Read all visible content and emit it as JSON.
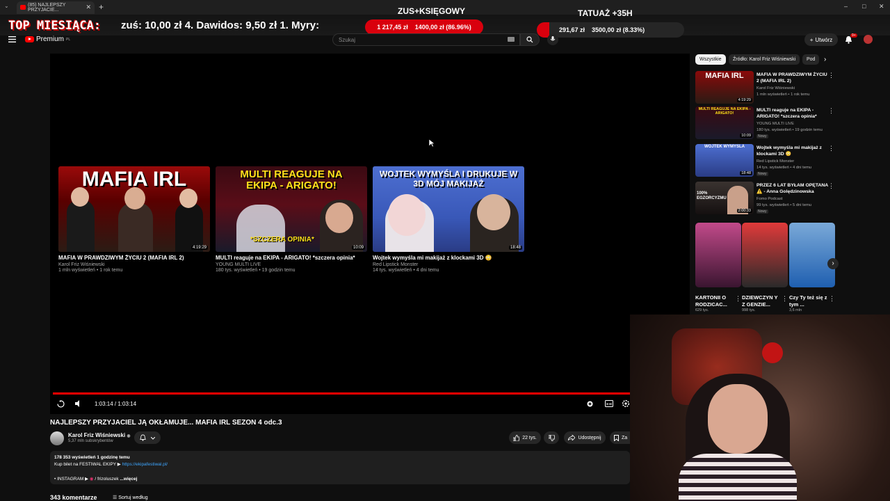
{
  "browser": {
    "tab_title": "(85) NAJLEPSZY PRZYJACIE...",
    "url_fragment": "v=zlhL8Dkc#M98",
    "new_tab": "+",
    "close": "✕",
    "window_controls": [
      "–",
      "□",
      "✕"
    ]
  },
  "overlay": {
    "top_label": "TOP MIESIĄCA:",
    "ticker": "zuś: 10,00 zł  4. Dawidos: 9,50 zł  1. Myry:",
    "goal1": {
      "title": "ZUS+KSIĘGOWY",
      "current": "1 217,45 zł",
      "target": "1400,00 zł (86.96%)",
      "percent": 86.96
    },
    "goal2": {
      "title": "TATUAŻ +35H",
      "current": "291,67 zł",
      "target": "3500,00 zł (8.33%)",
      "percent": 8.33
    }
  },
  "header": {
    "logo_text": "Premium",
    "logo_sup": "PL",
    "search_placeholder": "Szukaj",
    "create_label": "Utwórz",
    "notif_count": "9+"
  },
  "player": {
    "time": "1:03:14 / 1:03:14",
    "progress": 1.0,
    "endcards": [
      {
        "thumb_text": "MAFIA IRL",
        "title": "MAFIA W PRAWDZIWYM ŻYCIU 2 (MAFIA IRL 2)",
        "channel": "Karol Friz Wiśniewski",
        "meta": "1 mln wyświetleń • 1 rok temu",
        "duration": "4:19:29"
      },
      {
        "thumb_text": "MULTI REAGUJE NA EKIPA - ARIGATO!",
        "thumb_text2": "*SZCZERA OPINIA*",
        "title": "MULTI reaguje na EKIPA - ARIGATO! *szczera opinia*",
        "channel": "YOUNG MULTI LIVE",
        "meta": "180 tys. wyświetleń • 19 godzin temu",
        "duration": "10:09"
      },
      {
        "thumb_text": "WOJTEK WYMYŚLA I DRUKUJE W 3D MÓJ MAKIJAŻ",
        "title": "Wojtek wymyśla mi makijaż z klockami 3D 😳",
        "channel": "Red Lipstick Monster",
        "meta": "14 tys. wyświetleń • 4 dni temu",
        "duration": "18:48"
      }
    ]
  },
  "video": {
    "title": "NAJLEPSZY PRZYJACIEL JĄ OKŁAMUJE... MAFIA IRL SEZON 4 odc.3",
    "channel": "Karol Friz Wiśniewski",
    "subs": "5,37 mln subskrybentów",
    "likes": "22 tys.",
    "share": "Udostępnij",
    "save": "Za",
    "desc_stats": "178 353 wyświetleń  1 godzinę temu",
    "desc_line": "Kup bilet na FESTIWAL EKIPY ▶",
    "desc_link": "https://ekipafestiwal.pl/",
    "desc_insta": "• INSTAGRAM ▶",
    "desc_insta_handle": "/ frizoluszek",
    "desc_more": "...więcej",
    "comments": "343 komentarze",
    "sort": "Sortuj według"
  },
  "sidebar": {
    "chips": [
      "Wszystkie",
      "Źródło: Karol Friz Wiśniewski",
      "Pod"
    ],
    "recs": [
      {
        "title": "MAFIA W PRAWDZIWYM ŻYCIU 2 (MAFIA IRL 2)",
        "channel": "Karol Friz Wiśniewski",
        "meta": "1 mln wyświetleń • 1 rok temu",
        "duration": "4:19:29",
        "badge": "",
        "thumb": "MAFIA IRL"
      },
      {
        "title": "MULTI reaguje na EKIPA - ARIGATO! *szczera opinia*",
        "channel": "YOUNG MULTI LIVE",
        "meta": "180 tys. wyświetleń • 19 godzin temu",
        "duration": "10:09",
        "badge": "Nowy",
        "thumb": "MULTI REAGUJE NA EKIPA - ARIGATO!"
      },
      {
        "title": "Wojtek wymyśla mi makijaż z klockami 3D 😳",
        "channel": "Red Lipstick Monster",
        "meta": "14 tys. wyświetleń • 4 dni temu",
        "duration": "18:48",
        "badge": "Nowy",
        "thumb": "WOJTEK WYMYŚLA"
      },
      {
        "title": "PRZEZ 6 LAT BYŁAM OPĘTANA ⚠️ - Anna Golędzinowska",
        "channel": "Fomo Podcast",
        "meta": "99 tys. wyświetleń • 5 dni temu",
        "duration": "2:00:33",
        "badge": "Nowy",
        "thumb": "100% EGZORCYZMU"
      }
    ],
    "shorts": [
      {
        "title": "KARTONII O RODZICAC...",
        "meta": "629 tys."
      },
      {
        "title": "DZIEWCZYN Y Z GENZIE...",
        "meta": "998 tys."
      },
      {
        "title": "Czy Ty też się z tym ...",
        "meta": "3,6 mln"
      }
    ]
  },
  "colors": {
    "accent": "#ff0000",
    "background": "#0f0f0f",
    "goal_red": "#d9000d",
    "link": "#3ea6ff"
  }
}
